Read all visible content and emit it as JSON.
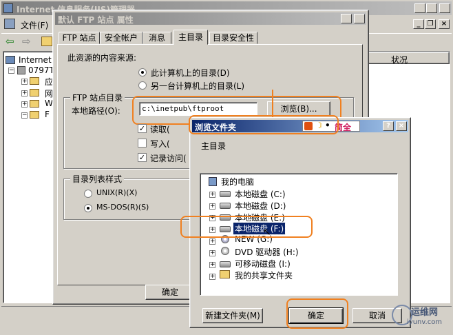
{
  "mmc": {
    "title": "Internet 信息服务(IIS)管理器",
    "menu_file": "文件(F)",
    "tree_root": "Internet",
    "tree_server": "0797T",
    "tree_items": [
      "应",
      "网",
      "W",
      "F"
    ],
    "column_status": "状况"
  },
  "props": {
    "title": "默认 FTP 站点 属性",
    "tabs": [
      "FTP 站点",
      "安全帐户",
      "消息",
      "主目录",
      "目录安全性"
    ],
    "source_label": "此资源的内容来源:",
    "radio_local": "此计算机上的目录(D)",
    "radio_share": "另一台计算机上的目录(L)",
    "group_ftp_dir": "FTP 站点目录",
    "local_path_label": "本地路径(O):",
    "local_path_value": "c:\\inetpub\\ftproot",
    "browse_button": "浏览(B)...",
    "check_read": "读取(",
    "check_write": "写入(",
    "check_log": "记录访问(",
    "group_listing": "目录列表样式",
    "radio_unix": "UNIX(R)(X)",
    "radio_msdos": "MS-DOS(R)(S)",
    "ok_button": "确定"
  },
  "browse": {
    "title": "浏览文件夹",
    "ime_text": "简全",
    "instruction": "主目录",
    "root_item": "我的电脑",
    "items": [
      {
        "label": "本地磁盘 (C:)",
        "icon": "hard-drive-icon",
        "selected": false
      },
      {
        "label": "本地磁盘 (D:)",
        "icon": "hard-drive-icon",
        "selected": false
      },
      {
        "label": "本地磁盘 (E:)",
        "icon": "hard-drive-icon",
        "selected": false
      },
      {
        "label": "本地磁盘 (F:)",
        "icon": "hard-drive-icon",
        "selected": true
      },
      {
        "label": "NEW (G:)",
        "icon": "cd-drive-icon",
        "selected": false
      },
      {
        "label": "DVD 驱动器 (H:)",
        "icon": "dvd-drive-icon",
        "selected": false
      },
      {
        "label": "可移动磁盘 (I:)",
        "icon": "removable-drive-icon",
        "selected": false
      },
      {
        "label": "我的共享文件夹",
        "icon": "shared-folder-icon",
        "selected": false
      }
    ],
    "new_folder_button": "新建文件夹(M)",
    "ok_button": "确定",
    "cancel_button": "取消"
  },
  "watermark": {
    "text": "运维网",
    "sub": "iyunv.com"
  },
  "colors": {
    "highlight_ring": "#f08020",
    "title_active": "#0a246a",
    "selection": "#0a246a"
  }
}
